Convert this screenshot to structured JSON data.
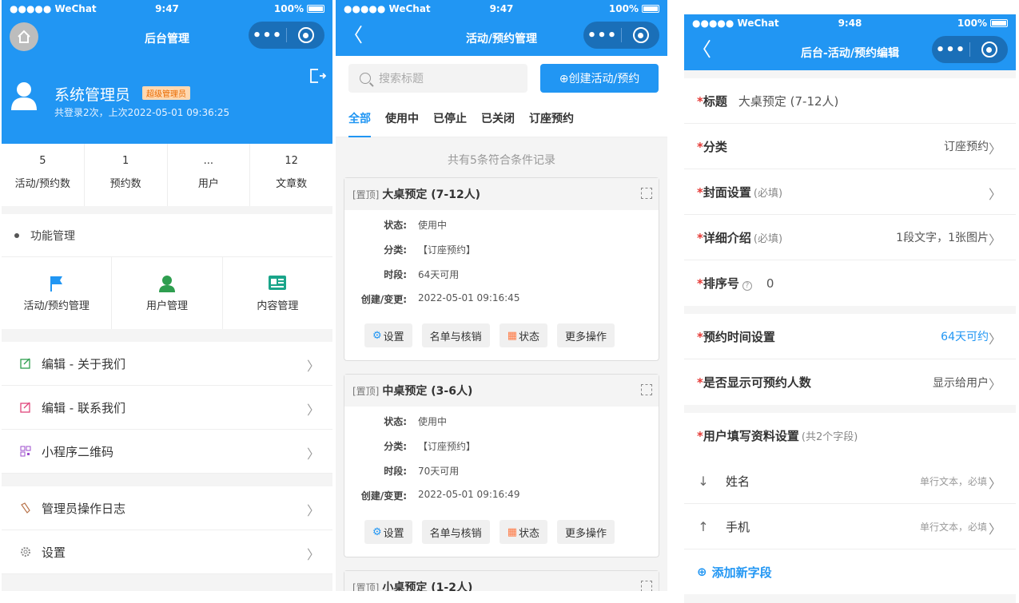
{
  "status": {
    "carrier": "●●●●● WeChat",
    "battery": "100%"
  },
  "p1": {
    "time": "9:47",
    "title": "后台管理",
    "user": {
      "name": "系统管理员",
      "badge": "超级管理员",
      "sub": "共登录2次，上次2022-05-01 09:36:25"
    },
    "stats": [
      {
        "n": "5",
        "l": "活动/预约数"
      },
      {
        "n": "1",
        "l": "预约数"
      },
      {
        "n": "...",
        "l": "用户"
      },
      {
        "n": "12",
        "l": "文章数"
      }
    ],
    "func_title": "功能管理",
    "funcs": [
      "活动/预约管理",
      "用户管理",
      "内容管理"
    ],
    "rows1": [
      "编辑 - 关于我们",
      "编辑 - 联系我们",
      "小程序二维码"
    ],
    "rows2": [
      "管理员操作日志",
      "设置"
    ]
  },
  "p2": {
    "time": "9:47",
    "title": "活动/预约管理",
    "search_placeholder": "搜索标题",
    "create": "⊕创建活动/预约",
    "tabs": [
      "全部",
      "使用中",
      "已停止",
      "已关闭",
      "订座预约"
    ],
    "count": "共有5条符合条件记录",
    "labels": {
      "status": "状态:",
      "cat": "分类:",
      "period": "时段:",
      "created": "创建/变更:",
      "top": "[置顶]"
    },
    "actions": [
      "设置",
      "名单与核销",
      "状态",
      "更多操作"
    ],
    "cards": [
      {
        "title": "大桌预定  (7-12人)",
        "status": "使用中",
        "cat": "【订座预约】",
        "period": "64天可用",
        "created": "2022-05-01 09:16:45"
      },
      {
        "title": "中桌预定 (3-6人)",
        "status": "使用中",
        "cat": "【订座预约】",
        "period": "70天可用",
        "created": "2022-05-01 09:16:49"
      },
      {
        "title": "小桌预定 (1-2人)"
      }
    ]
  },
  "p3": {
    "time": "9:48",
    "title": "后台-活动/预约编辑",
    "rows": {
      "title_l": "标题",
      "title_v": "大桌预定  (7-12人)",
      "cat_l": "分类",
      "cat_v": "订座预约",
      "cover_l": "封面设置",
      "cover_h": "(必填)",
      "detail_l": "详细介绍",
      "detail_h": "(必填)",
      "detail_v": "1段文字，1张图片",
      "sort_l": "排序号",
      "sort_v": "0",
      "time_l": "预约时间设置",
      "time_v": "64天可约",
      "show_l": "是否显示可预约人数",
      "show_v": "显示给用户",
      "fields_l": "用户填写资料设置",
      "fields_h": "(共2个字段)"
    },
    "fields": [
      {
        "name": "姓名",
        "desc": "单行文本，必填",
        "arrow": "↓"
      },
      {
        "name": "手机",
        "desc": "单行文本，必填",
        "arrow": "↑"
      }
    ],
    "add": "添加新字段"
  }
}
